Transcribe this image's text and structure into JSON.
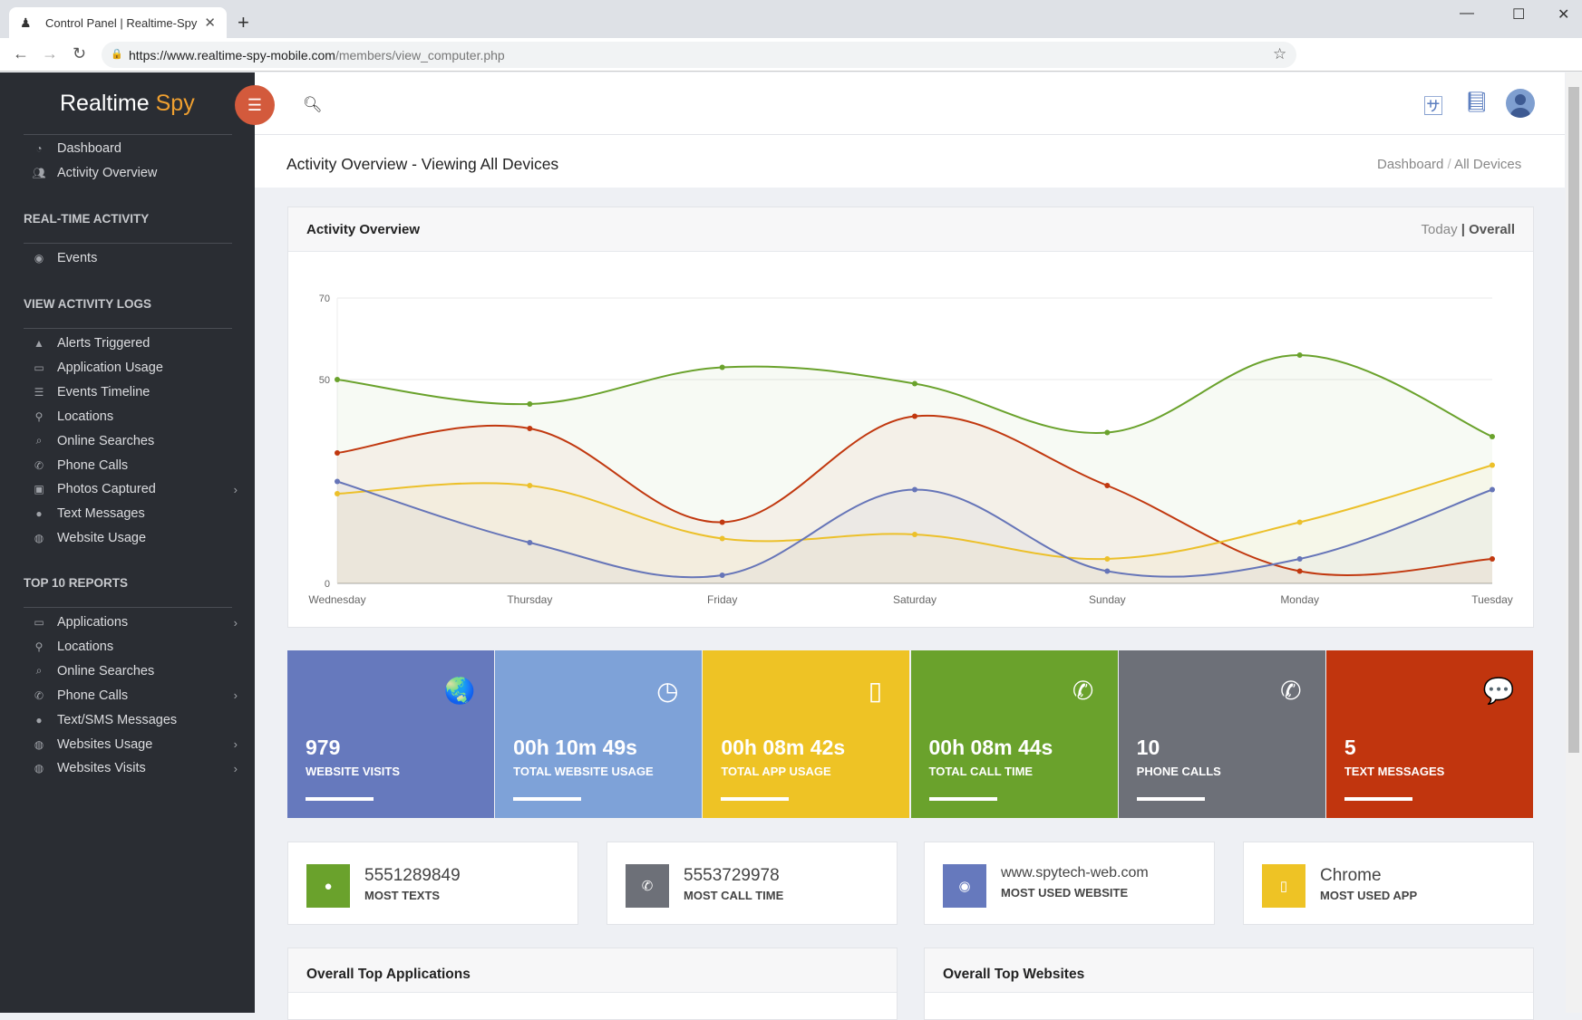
{
  "browser": {
    "tab_title": "Control Panel | Realtime-Spy",
    "url_host": "https://www.realtime-spy-mobile.com",
    "url_path": "/members/view_computer.php"
  },
  "sidebar": {
    "logo_a": "Realtime",
    "logo_b": "Spy",
    "top": [
      {
        "label": "Dashboard",
        "icon": "dashboard-icon"
      },
      {
        "label": "Activity Overview",
        "icon": "users-icon"
      }
    ],
    "sections": [
      {
        "title": "REAL-TIME ACTIVITY",
        "items": [
          {
            "label": "Events",
            "icon": "eye-icon"
          }
        ]
      },
      {
        "title": "VIEW ACTIVITY LOGS",
        "items": [
          {
            "label": "Alerts Triggered",
            "icon": "warning-icon"
          },
          {
            "label": "Application Usage",
            "icon": "monitor-icon"
          },
          {
            "label": "Events Timeline",
            "icon": "list-icon"
          },
          {
            "label": "Locations",
            "icon": "pin-icon"
          },
          {
            "label": "Online Searches",
            "icon": "search-icon"
          },
          {
            "label": "Phone Calls",
            "icon": "phone-icon"
          },
          {
            "label": "Photos Captured",
            "icon": "image-icon",
            "chev": true
          },
          {
            "label": "Text Messages",
            "icon": "chat-icon"
          },
          {
            "label": "Website Usage",
            "icon": "globe-icon"
          }
        ]
      },
      {
        "title": "TOP 10 REPORTS",
        "items": [
          {
            "label": "Applications",
            "icon": "monitor-icon",
            "chev": true
          },
          {
            "label": "Locations",
            "icon": "pin-icon"
          },
          {
            "label": "Online Searches",
            "icon": "search-icon"
          },
          {
            "label": "Phone Calls",
            "icon": "phone-icon",
            "chev": true
          },
          {
            "label": "Text/SMS Messages",
            "icon": "chat-icon"
          },
          {
            "label": "Websites Usage",
            "icon": "globe-icon",
            "chev": true
          },
          {
            "label": "Websites Visits",
            "icon": "globe-icon",
            "chev": true
          }
        ]
      }
    ]
  },
  "page": {
    "title": "Activity Overview - Viewing All Devices",
    "breadcrumb": [
      "Dashboard",
      "All Devices"
    ]
  },
  "chart_card": {
    "title": "Activity Overview",
    "toggle_today": "Today",
    "toggle_sep": "|",
    "toggle_overall": "Overall"
  },
  "chart_data": {
    "type": "area",
    "categories": [
      "Wednesday",
      "Thursday",
      "Friday",
      "Saturday",
      "Sunday",
      "Monday",
      "Tuesday"
    ],
    "ylim": [
      0,
      70
    ],
    "yticks": [
      0,
      50,
      70
    ],
    "grid": true,
    "smooth": true,
    "series": [
      {
        "color": "#6aa22c",
        "values": [
          50,
          44,
          53,
          49,
          37,
          56,
          36
        ]
      },
      {
        "color": "#c1380f",
        "values": [
          32,
          38,
          15,
          41,
          24,
          3,
          6
        ]
      },
      {
        "color": "#ecc02a",
        "values": [
          22,
          24,
          11,
          12,
          6,
          15,
          29
        ]
      },
      {
        "color": "#6675b8",
        "values": [
          25,
          10,
          2,
          23,
          3,
          6,
          23
        ]
      }
    ]
  },
  "tiles": [
    {
      "value": "979",
      "label": "WEBSITE VISITS",
      "color": "#6679bd",
      "icon": "globe-icon",
      "glyph": "🌏"
    },
    {
      "value": "00h 10m 49s",
      "label": "TOTAL WEBSITE USAGE",
      "color": "#7ea2d8",
      "icon": "clock-icon",
      "glyph": "◷"
    },
    {
      "value": "00h 08m 42s",
      "label": "TOTAL APP USAGE",
      "color": "#eec325",
      "icon": "mobile-icon",
      "glyph": "▯"
    },
    {
      "value": "00h 08m 44s",
      "label": "TOTAL CALL TIME",
      "color": "#6aa22c",
      "icon": "phone-icon",
      "glyph": "✆"
    },
    {
      "value": "10",
      "label": "PHONE CALLS",
      "color": "#6d7078",
      "icon": "phone-icon",
      "glyph": "✆"
    },
    {
      "value": "5",
      "label": "TEXT MESSAGES",
      "color": "#c1350e",
      "icon": "chat-icon",
      "glyph": "💬"
    }
  ],
  "info": [
    {
      "value": "5551289849",
      "label": "MOST TEXTS",
      "color": "#6aa22c",
      "icon": "chat-icon",
      "glyph": "●"
    },
    {
      "value": "5553729978",
      "label": "MOST CALL TIME",
      "color": "#6d7078",
      "icon": "phone-icon",
      "glyph": "✆"
    },
    {
      "value": "www.spytech-web.com",
      "label": "MOST USED WEBSITE",
      "color": "#6679bd",
      "icon": "globe-icon",
      "glyph": "◉"
    },
    {
      "value": "Chrome",
      "label": "MOST USED APP",
      "color": "#eec325",
      "icon": "mobile-icon",
      "glyph": "▯"
    }
  ],
  "panels": [
    "Overall Top Applications",
    "Overall Top Websites"
  ]
}
